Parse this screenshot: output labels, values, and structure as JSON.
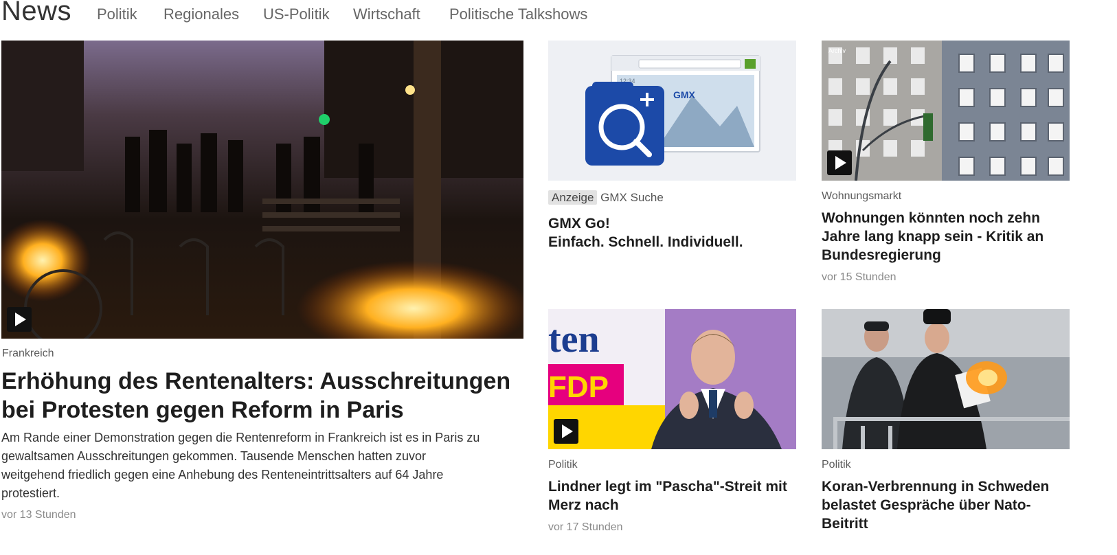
{
  "header": {
    "brand": "News",
    "nav": [
      "Politik",
      "Regionales",
      "US-Politik",
      "Wirtschaft",
      "Politische Talkshows"
    ]
  },
  "lead": {
    "image_desc": "play-video",
    "kicker": "Frankreich",
    "headline_line1": "Erhöhung des Rentenalters: Ausschreitungen",
    "headline_line2": "bei Protesten gegen Reform in Paris",
    "teaser": [
      "Am Rande einer Demonstration gegen die Rentenreform in Frankreich ist es in Paris zu",
      "gewaltsamen Ausschreitungen gekommen. Tausende Menschen hatten zuvor",
      "weitgehend friedlich gegen eine Anhebung des Renteneintrittsalters auf 64 Jahre",
      "protestiert."
    ],
    "time": "vor 13 Stunden"
  },
  "ad": {
    "badge": "Anzeige",
    "source": "GMX Suche",
    "title_line1": "GMX Go!",
    "title_line2": "Einfach. Schnell. Individuell.",
    "logo_text": "GMX",
    "clock_text": "12:34"
  },
  "card_housing": {
    "kicker": "Wohnungsmarkt",
    "headline": [
      "Wohnungen könnten noch zehn",
      "Jahre lang knapp sein - Kritik an",
      "Bundesregierung"
    ],
    "time": "vor 15 Stunden",
    "corner_label": "Archiv"
  },
  "card_lindner": {
    "kicker": "Politik",
    "headline": [
      "Lindner legt im \"Pascha\"-Streit mit",
      "Merz nach"
    ],
    "time": "vor 17 Stunden",
    "sign_top": "ten",
    "sign_bottom": "FDP"
  },
  "card_koran": {
    "kicker": "Politik",
    "headline": [
      "Koran-Verbrennung in Schweden",
      "belastet Gespräche über Nato-",
      "Beitritt"
    ]
  },
  "colors": {
    "fire": "#ff9a1a",
    "fdp_magenta": "#e6007e",
    "fdp_yellow": "#ffd600",
    "gmx_blue": "#1c4aa8"
  }
}
